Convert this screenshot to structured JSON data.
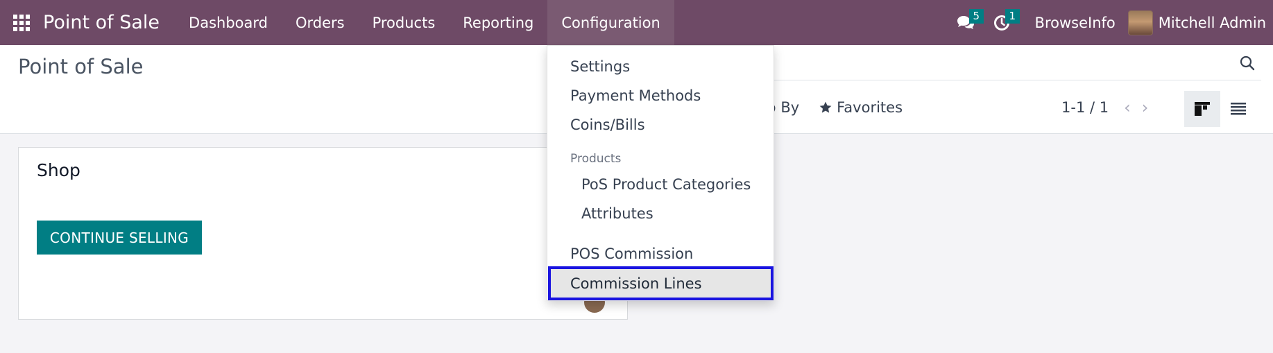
{
  "navbar": {
    "brand": "Point of Sale",
    "menu": [
      "Dashboard",
      "Orders",
      "Products",
      "Reporting",
      "Configuration"
    ],
    "messages_badge": "5",
    "activities_badge": "1",
    "company": "BrowseInfo",
    "user": "Mitchell Admin"
  },
  "control_panel": {
    "title": "Point of Sale",
    "group_by_partial": "up By",
    "favorites": "Favorites",
    "pager": "1-1 / 1"
  },
  "card": {
    "title": "Shop",
    "button": "CONTINUE SELLING"
  },
  "dropdown": {
    "settings": "Settings",
    "payment_methods": "Payment Methods",
    "coins_bills": "Coins/Bills",
    "products_header": "Products",
    "pos_product_categories": "PoS Product Categories",
    "attributes": "Attributes",
    "pos_commission": "POS Commission",
    "commission_lines": "Commission Lines"
  },
  "colors": {
    "navbar": "#6e4a66",
    "accent": "#017e84",
    "highlight_border": "#1a14e0"
  }
}
